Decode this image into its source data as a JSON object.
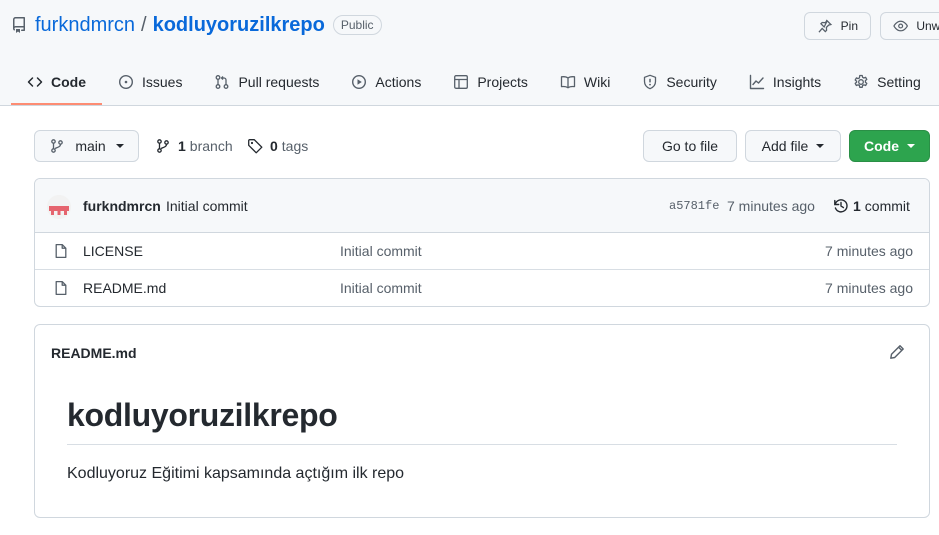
{
  "repo": {
    "owner": "furkndmrcn",
    "separator": "/",
    "name": "kodluyoruzilkrepo",
    "visibility": "Public"
  },
  "header_buttons": {
    "pin": "Pin",
    "unwatch": "Unwa"
  },
  "tabs": [
    {
      "label": "Code",
      "icon": "code-icon",
      "active": true
    },
    {
      "label": "Issues",
      "icon": "issue-icon"
    },
    {
      "label": "Pull requests",
      "icon": "pull-request-icon"
    },
    {
      "label": "Actions",
      "icon": "play-icon"
    },
    {
      "label": "Projects",
      "icon": "table-icon"
    },
    {
      "label": "Wiki",
      "icon": "book-icon"
    },
    {
      "label": "Security",
      "icon": "shield-icon"
    },
    {
      "label": "Insights",
      "icon": "graph-icon"
    },
    {
      "label": "Setting",
      "icon": "gear-icon"
    }
  ],
  "toolbar": {
    "branch": "main",
    "branch_count": "1",
    "branch_label": "branch",
    "tag_count": "0",
    "tag_label": "tags",
    "go_to_file": "Go to file",
    "add_file": "Add file",
    "code": "Code"
  },
  "latest_commit": {
    "author": "furkndmrcn",
    "message": "Initial commit",
    "sha": "a5781fe",
    "time": "7 minutes ago",
    "count": "1",
    "count_label": "commit"
  },
  "files": [
    {
      "name": "LICENSE",
      "message": "Initial commit",
      "date": "7 minutes ago"
    },
    {
      "name": "README.md",
      "message": "Initial commit",
      "date": "7 minutes ago"
    }
  ],
  "readme": {
    "filename": "README.md",
    "heading": "kodluyoruzilkrepo",
    "body": "Kodluyoruz Eğitimi kapsamında açtığım ilk repo"
  },
  "colors": {
    "link": "#0969da",
    "accent_underline": "#fd8c73",
    "code_button": "#2da44e"
  }
}
